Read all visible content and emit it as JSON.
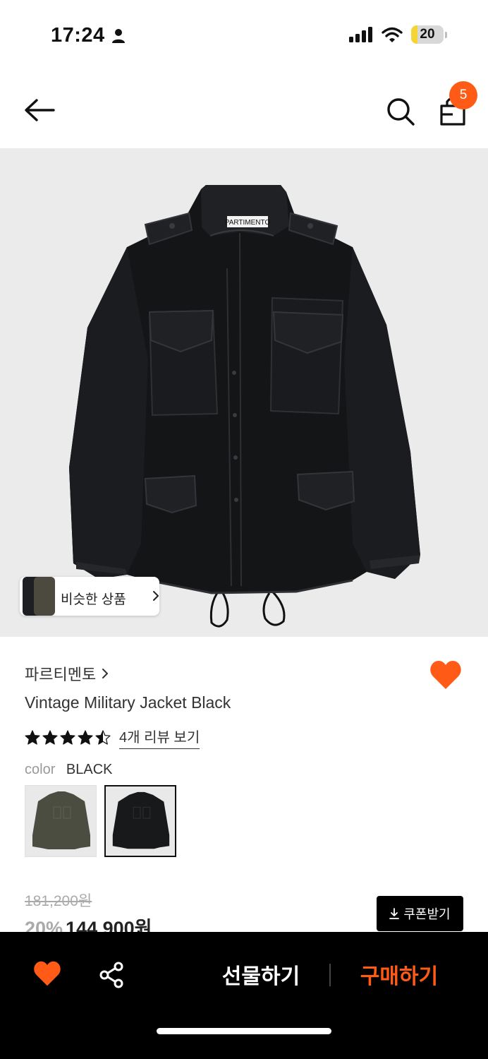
{
  "status_bar": {
    "time": "17:24",
    "battery": "20",
    "battery_level": 0.2,
    "icons": [
      "person-icon",
      "signal-icon",
      "wifi-icon",
      "battery-icon"
    ]
  },
  "header": {
    "icons": [
      "back-arrow-icon",
      "search-icon",
      "shopping-bag-icon"
    ],
    "cart_count": "5"
  },
  "product_image": {
    "label_text": "PARTIMENTO",
    "similar_items_label": "비슷한 상품"
  },
  "product": {
    "brand": "파르티멘토",
    "title": "Vintage Military Jacket Black",
    "rating": 4.5,
    "review_link": "4개 리뷰 보기",
    "color_label": "color",
    "color_value": "BLACK",
    "swatches": [
      {
        "name": "olive",
        "color": "#4b4d40",
        "selected": false
      },
      {
        "name": "black",
        "color": "#17191b",
        "selected": true
      }
    ],
    "original_price": "181,200원",
    "discount": "20%",
    "final_price": "144,900원",
    "coupon_button": "쿠폰받기"
  },
  "bottom_bar": {
    "gift_button": "선물하기",
    "buy_button": "구매하기"
  },
  "colors": {
    "accent": "#ff5a16",
    "bottom_bar_bg": "#000000",
    "image_bg": "#ebebeb"
  }
}
